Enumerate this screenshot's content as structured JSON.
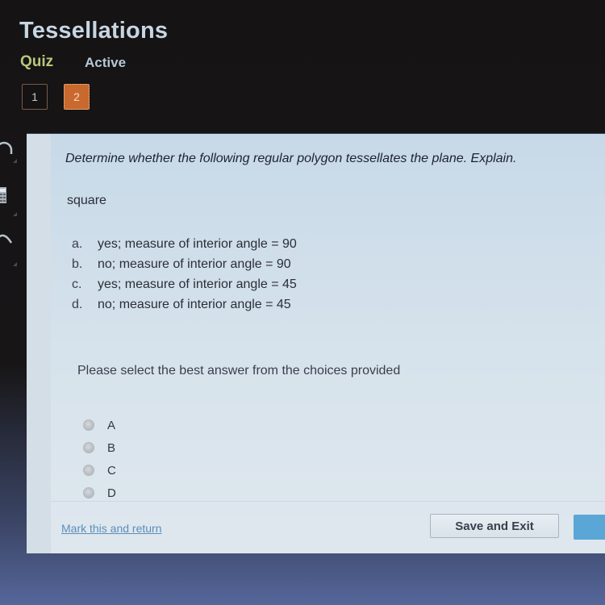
{
  "header": {
    "title": "Tessellations",
    "activity_type": "Quiz",
    "status": "Active"
  },
  "question_nav": [
    {
      "label": "1",
      "active": false
    },
    {
      "label": "2",
      "active": true
    }
  ],
  "sidebar": {
    "icons": [
      "headphones-icon",
      "calculator-icon",
      "graph-icon"
    ]
  },
  "question": {
    "prompt": "Determine whether the following regular polygon tessellates the plane. Explain.",
    "shape": "square",
    "choices": [
      {
        "letter": "a.",
        "text": "yes; measure of interior angle = 90"
      },
      {
        "letter": "b.",
        "text": "no; measure of interior angle = 90"
      },
      {
        "letter": "c.",
        "text": "yes; measure of interior angle = 45"
      },
      {
        "letter": "d.",
        "text": "no; measure of interior angle = 45"
      }
    ]
  },
  "answer": {
    "instruction": "Please select the best answer from the choices provided",
    "options": [
      {
        "label": "A",
        "selected": false
      },
      {
        "label": "B",
        "selected": false
      },
      {
        "label": "C",
        "selected": false
      },
      {
        "label": "D",
        "selected": false
      }
    ]
  },
  "footer": {
    "mark_link": "Mark this and return",
    "save_button": "Save and Exit"
  },
  "colors": {
    "accent_orange": "#c9692e",
    "quiz_label": "#b7c77c",
    "link": "#5b8fb8",
    "next_button": "#5aa6d6"
  }
}
